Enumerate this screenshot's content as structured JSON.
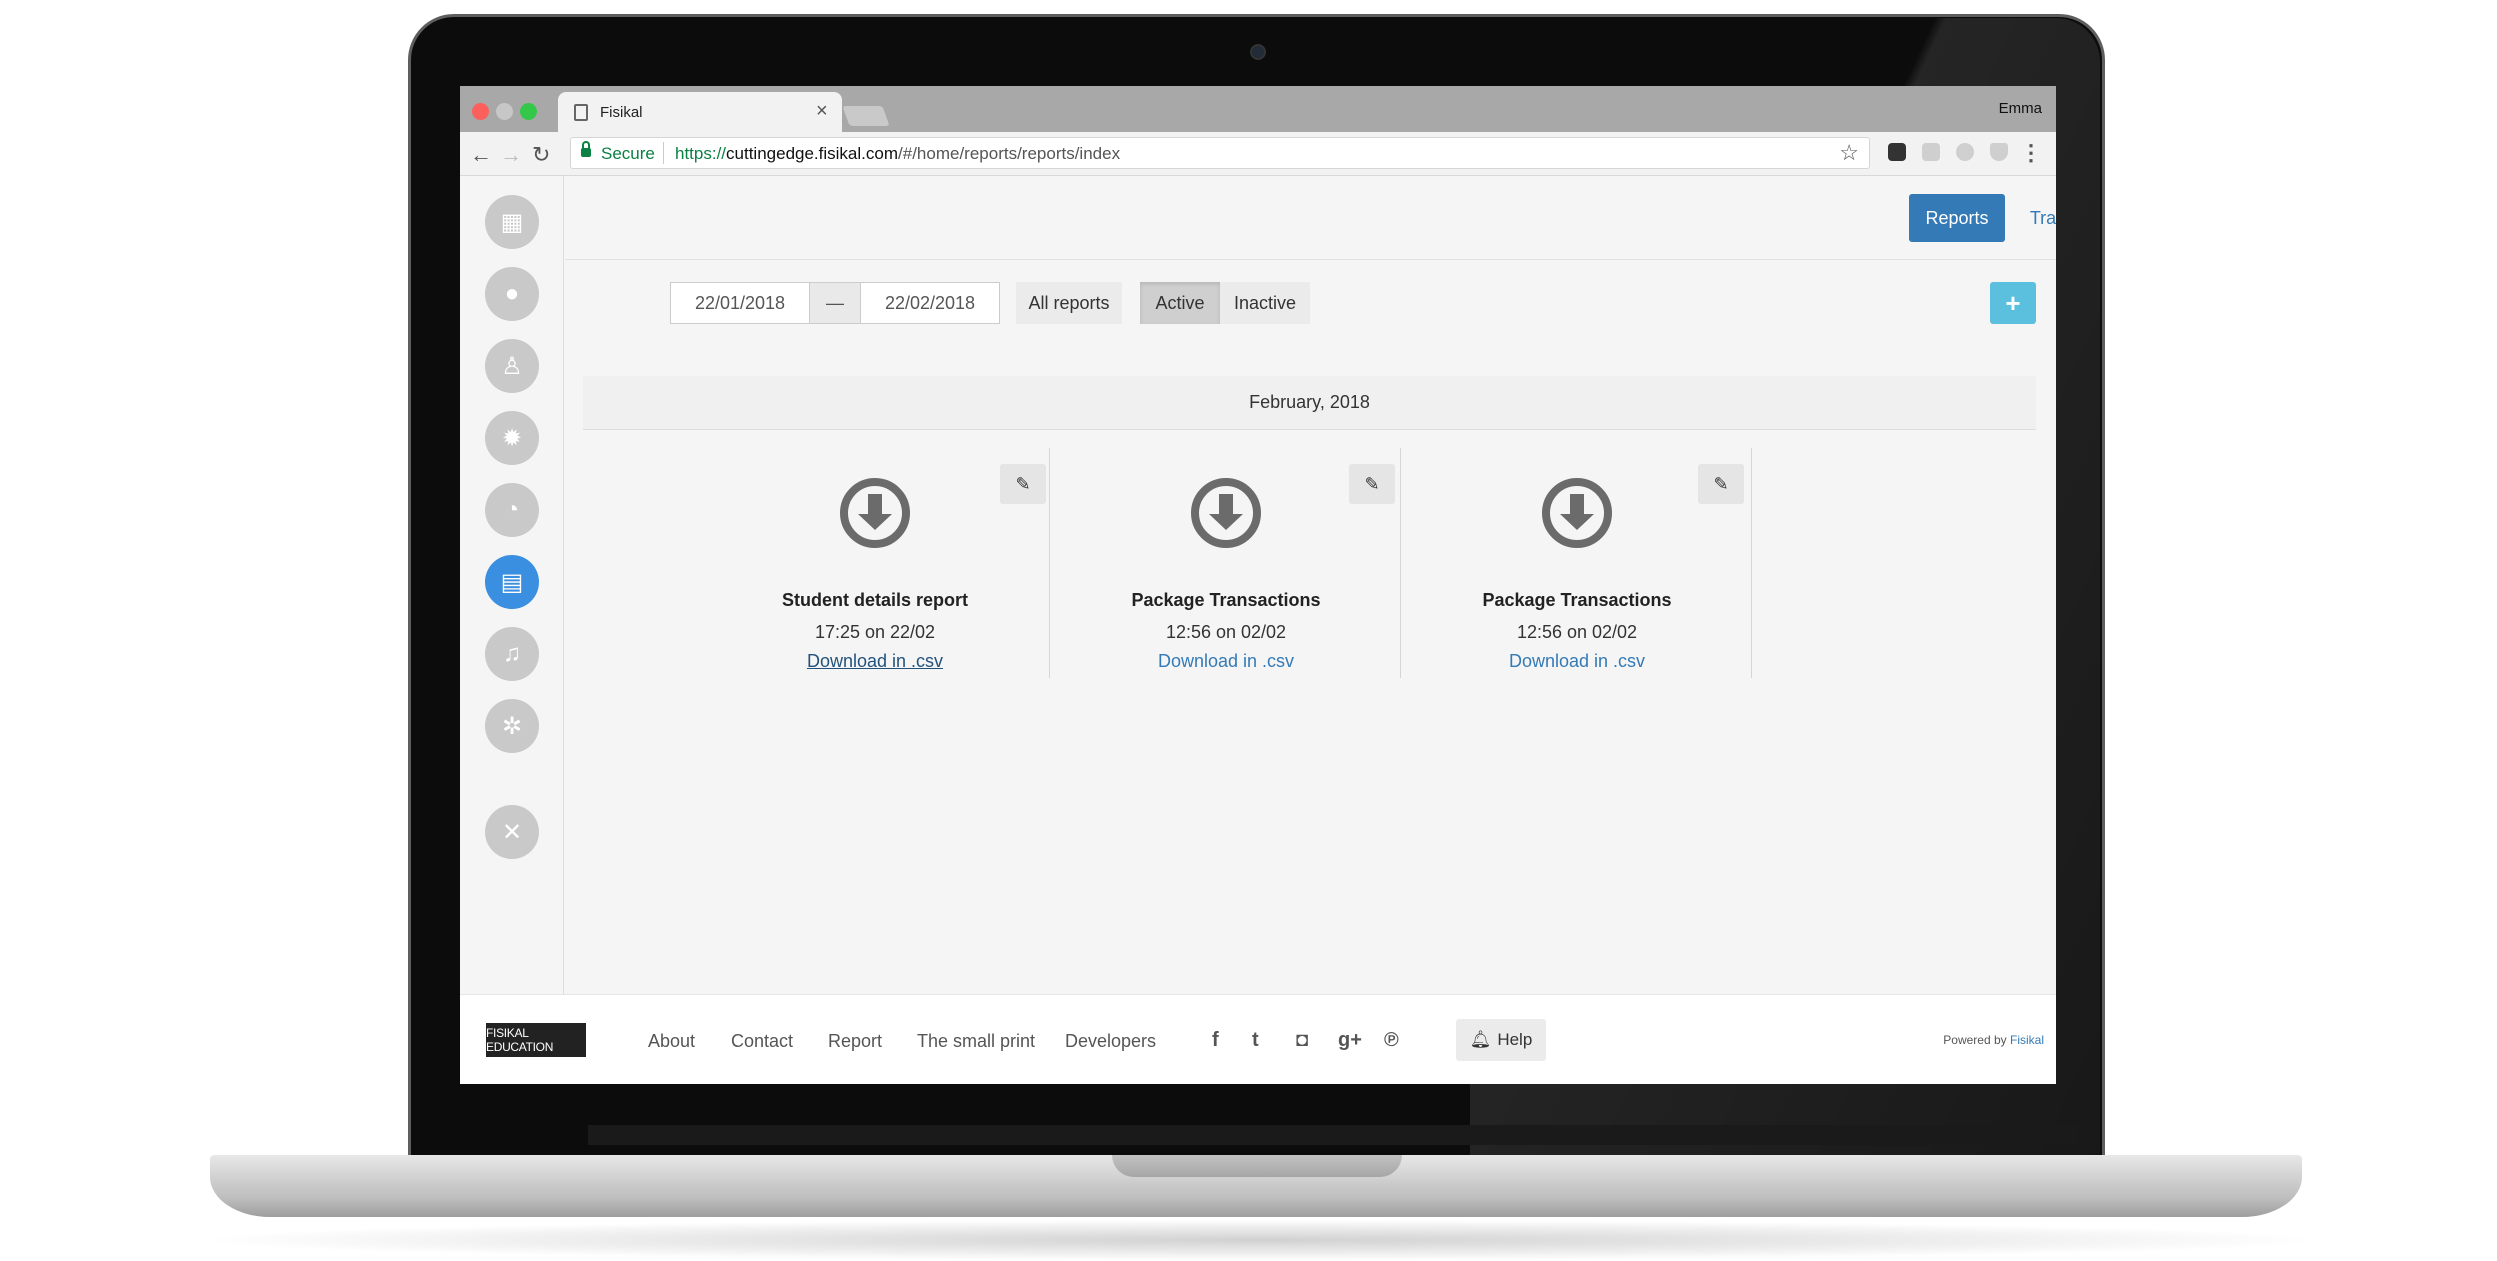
{
  "browser": {
    "tab_title": "Fisikal",
    "profile_name": "Emma",
    "secure_label": "Secure",
    "url_scheme": "https://",
    "url_host": "cuttingedge.fisikal.com",
    "url_path": "/#/home/reports/reports/index"
  },
  "header": {
    "reports_label": "Reports",
    "transactions_label": "Transactions"
  },
  "filters": {
    "date_from": "22/01/2018",
    "date_separator": "—",
    "date_to": "22/02/2018",
    "all_reports_label": "All reports",
    "active_label": "Active",
    "inactive_label": "Inactive",
    "add_label": "+"
  },
  "month_label": "February, 2018",
  "reports": [
    {
      "title": "Student details report",
      "time": "17:25 on 22/02",
      "link": "Download in .csv"
    },
    {
      "title": "Package Transactions",
      "time": "12:56 on 02/02",
      "link": "Download in .csv"
    },
    {
      "title": "Package Transactions",
      "time": "12:56 on 02/02",
      "link": "Download in .csv"
    }
  ],
  "footer": {
    "brand": "FISIKAL EDUCATION",
    "links": [
      "About",
      "Contact",
      "Report",
      "The small print",
      "Developers"
    ],
    "help_label": "Help",
    "powered_prefix": "Powered by",
    "powered_brand": "Fisikal"
  },
  "icons": {
    "sidebar": [
      "calendar-icon",
      "group-icon",
      "user-icon",
      "badge-icon",
      "dashboard-icon",
      "reports-icon",
      "bell-icon",
      "gear-icon",
      "close-icon"
    ],
    "social": [
      "facebook-icon",
      "twitter-icon",
      "instagram-icon",
      "google-plus-icon",
      "pinterest-icon"
    ]
  },
  "colors": {
    "primary": "#337ab7",
    "active_sidebar": "#3b8fe0",
    "add_button": "#5bc0de"
  }
}
